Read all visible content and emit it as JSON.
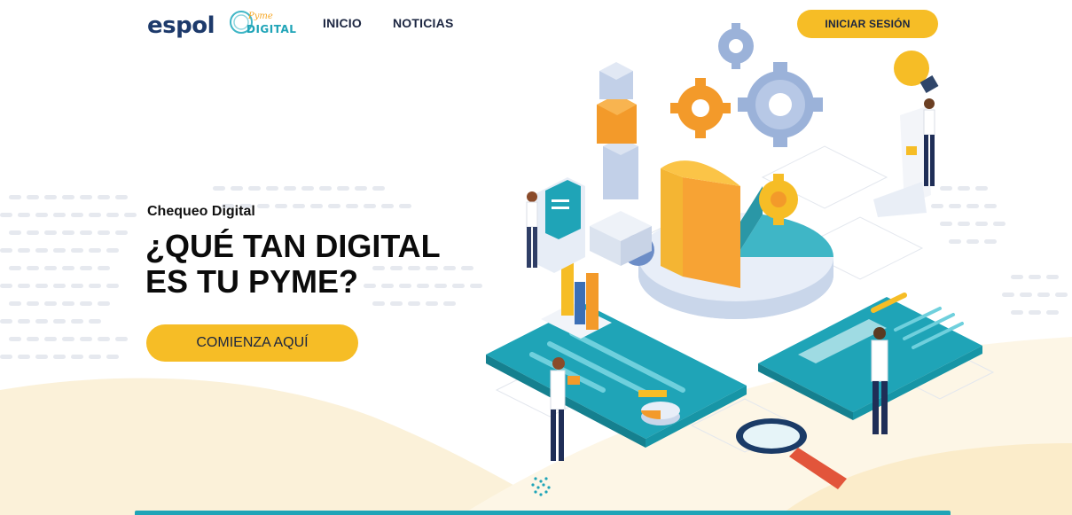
{
  "header": {
    "espol_logo": "espol",
    "pyme_logo_top": "Pyme",
    "pyme_logo_bottom": "DIGITAL",
    "nav": [
      {
        "label": "INICIO"
      },
      {
        "label": "NOTICIAS"
      }
    ],
    "login_label": "INICIAR SESIÓN"
  },
  "hero": {
    "kicker": "Chequeo Digital",
    "headline_line1": "¿QUÉ TAN DIGITAL",
    "headline_line2": "ES TU PYME?",
    "cta_label": "COMIENZA AQUÍ"
  },
  "colors": {
    "accent_yellow": "#f6bd26",
    "teal": "#1fa4b7",
    "navy": "#1d3a6b"
  }
}
